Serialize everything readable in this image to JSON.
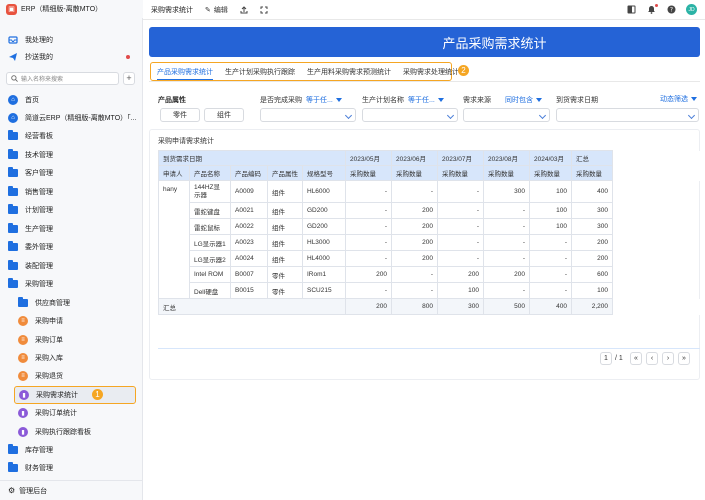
{
  "app": {
    "title": "ERP（精细版-离散MTO）",
    "logo": "ERP"
  },
  "sidebar": {
    "top_items": [
      {
        "label": "我处理的",
        "icon": "inbox-icon"
      },
      {
        "label": "抄送我的",
        "icon": "send-icon"
      }
    ],
    "search_placeholder": "输入名称来搜索",
    "items": [
      {
        "label": "首页",
        "icon": "home-icon"
      },
      {
        "label": "简道云ERP（精细版-离散MTO）「...",
        "icon": "home-icon"
      },
      {
        "label": "经营看板",
        "icon": "folder-icon"
      },
      {
        "label": "技术管理",
        "icon": "folder-icon"
      },
      {
        "label": "客户管理",
        "icon": "folder-icon"
      },
      {
        "label": "销售管理",
        "icon": "folder-icon"
      },
      {
        "label": "计划管理",
        "icon": "folder-icon"
      },
      {
        "label": "生产管理",
        "icon": "folder-icon"
      },
      {
        "label": "委外管理",
        "icon": "folder-icon"
      },
      {
        "label": "装配管理",
        "icon": "folder-icon"
      },
      {
        "label": "采购管理",
        "icon": "folder-open-icon"
      },
      {
        "label": "供应商管理",
        "icon": "folder-icon"
      },
      {
        "label": "采购申请",
        "icon": "form-icon"
      },
      {
        "label": "采购订单",
        "icon": "form-icon"
      },
      {
        "label": "采购入库",
        "icon": "form-icon"
      },
      {
        "label": "采购退货",
        "icon": "form-icon"
      },
      {
        "label": "采购需求统计",
        "icon": "report-icon"
      },
      {
        "label": "采购订单统计",
        "icon": "report-icon"
      },
      {
        "label": "采购执行跟踪看板",
        "icon": "report-icon"
      },
      {
        "label": "库存管理",
        "icon": "folder-icon"
      },
      {
        "label": "财务管理",
        "icon": "folder-icon"
      }
    ],
    "admin_label": "管理后台",
    "callout_1": "1"
  },
  "topbar": {
    "title": "采购需求统计",
    "edit_label": "编辑",
    "avatar_text": "JD"
  },
  "banner": {
    "title": "产品采购需求统计"
  },
  "tabs": {
    "items": [
      "产品采购需求统计",
      "生产计划采购执行跟踪",
      "生产用料采购需求预测统计",
      "采购需求处理统计"
    ],
    "callout_2": "2"
  },
  "filters": {
    "product_attr_label": "产品属性",
    "product_attr_options": [
      "零件",
      "组件"
    ],
    "completed_label": "是否完成采购",
    "completed_value": "等于任...",
    "plan_name_label": "生产计划名称",
    "plan_name_value": "等于任...",
    "source_label": "需求来源",
    "source_value": "同时包含",
    "date_label": "到货需求日期",
    "dynamic_filter": "动态筛选"
  },
  "table": {
    "title": "采购申请需求统计",
    "header1": {
      "date_label": "到货需求日期",
      "months": [
        "2023/05月",
        "2023/06月",
        "2023/07月",
        "2023/08月",
        "2024/03月"
      ],
      "total": "汇总"
    },
    "header2": [
      "申请人",
      "产品名称",
      "产品编码",
      "产品属性",
      "规格型号",
      "采购数量",
      "采购数量",
      "采购数量",
      "采购数量",
      "采购数量",
      "采购数量"
    ],
    "applicant": "hany",
    "rows": [
      [
        "144HZ显示器",
        "A0009",
        "组件",
        "HL6000",
        "-",
        "-",
        "-",
        "300",
        "100",
        "400"
      ],
      [
        "雷蛇键盘",
        "A0021",
        "组件",
        "GD200",
        "-",
        "200",
        "-",
        "-",
        "100",
        "300"
      ],
      [
        "雷蛇鼠标",
        "A0022",
        "组件",
        "GD200",
        "-",
        "200",
        "-",
        "-",
        "100",
        "300"
      ],
      [
        "LG显示器1",
        "A0023",
        "组件",
        "HL3000",
        "-",
        "200",
        "-",
        "-",
        "-",
        "200"
      ],
      [
        "LG显示器2",
        "A0024",
        "组件",
        "HL4000",
        "-",
        "200",
        "-",
        "-",
        "-",
        "200"
      ],
      [
        "Intel ROM",
        "B0007",
        "零件",
        "IRom1",
        "200",
        "-",
        "200",
        "200",
        "-",
        "600"
      ],
      [
        "Dell硬盘",
        "B0015",
        "零件",
        "SCU215",
        "-",
        "-",
        "100",
        "-",
        "-",
        "100"
      ]
    ],
    "total_row": {
      "label": "汇总",
      "values": [
        "200",
        "800",
        "300",
        "500",
        "400",
        "2,200"
      ]
    }
  },
  "pager": {
    "page": "1",
    "of": "/ 1"
  }
}
